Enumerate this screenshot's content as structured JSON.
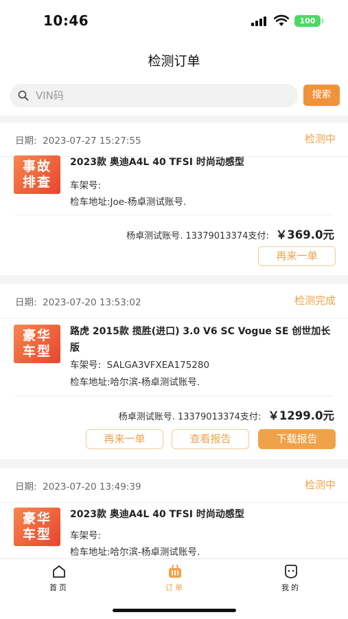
{
  "status_bar": {
    "time": "10:46",
    "battery": "100"
  },
  "nav": {
    "title": "检测订单"
  },
  "search": {
    "placeholder": "VIN码",
    "button_label": "搜索"
  },
  "orders": [
    {
      "date_label": "日期:",
      "date": "2023-07-27 15:27:55",
      "status": "检测中",
      "thumb_text_1": "事故",
      "thumb_text_2": "排查",
      "title": "2023款 奥迪A4L 40 TFSI 时尚动感型",
      "frame_label": "车架号:",
      "frame_value": "",
      "address": "检车地址:Joe-杨卓测试账号.",
      "payer": "杨卓测试账号. 13379013374支付:",
      "amount": "￥369.0元",
      "buttons": [
        "再来一单"
      ]
    },
    {
      "date_label": "日期:",
      "date": "2023-07-20 13:53:02",
      "status": "检测完成",
      "thumb_text_1": "豪华",
      "thumb_text_2": "车型",
      "title": "路虎 2015款 揽胜(进口) 3.0 V6 SC Vogue SE 创世加长版",
      "frame_label": "车架号:",
      "frame_value": "SALGA3VFXEA175280",
      "address": "检车地址:哈尔滨-杨卓测试账号.",
      "payer": "杨卓测试账号. 13379013374支付:",
      "amount": "￥1299.0元",
      "buttons": [
        "再来一单",
        "查看报告",
        "下载报告"
      ]
    },
    {
      "date_label": "日期:",
      "date": "2023-07-20 13:49:39",
      "status": "检测中",
      "thumb_text_1": "豪华",
      "thumb_text_2": "车型",
      "title": "2023款 奥迪A4L 40 TFSI 时尚动感型",
      "frame_label": "车架号:",
      "frame_value": "",
      "address": "检车地址:哈尔滨-杨卓测试账号."
    }
  ],
  "tabs": [
    {
      "label": "首页",
      "icon": "home-icon"
    },
    {
      "label": "订单",
      "icon": "order-basket-icon",
      "active": true
    },
    {
      "label": "我的",
      "icon": "profile-face-icon"
    }
  ],
  "colors": {
    "accent": "#f0a24a",
    "search_button": "#f0923a",
    "thumb_start": "#f6874d",
    "thumb_end": "#e8452f",
    "battery": "#4cd964"
  }
}
